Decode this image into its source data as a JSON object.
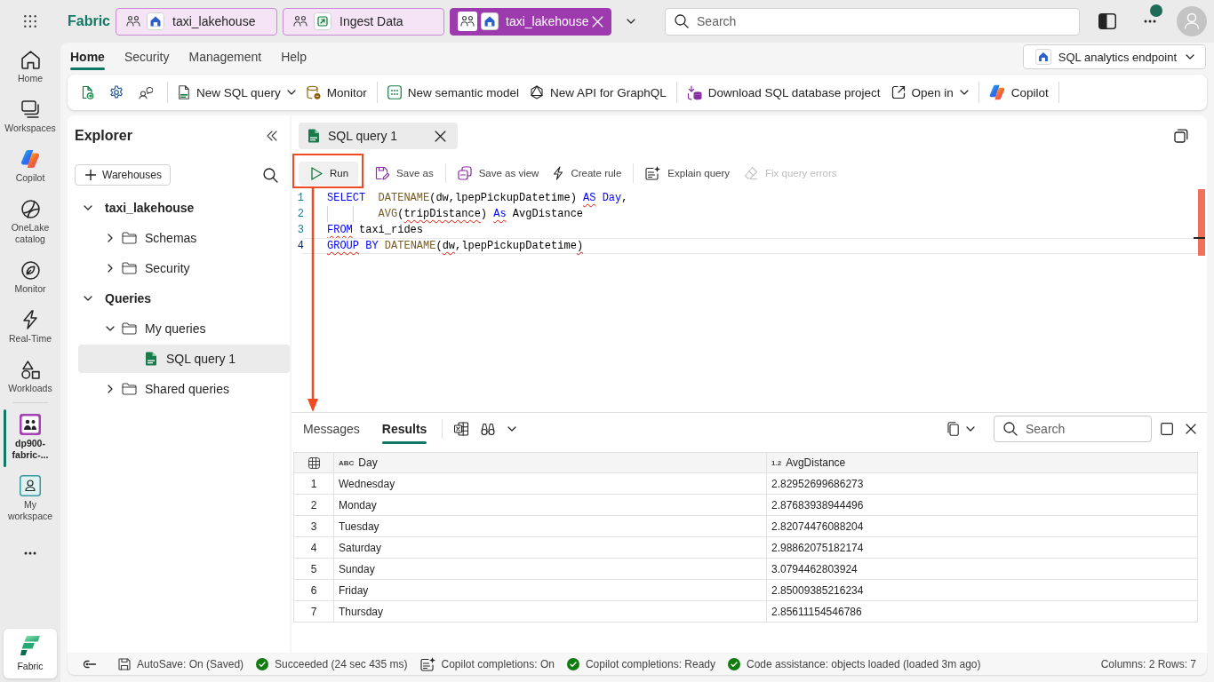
{
  "header": {
    "app_name": "Fabric",
    "tabs": [
      {
        "label": "taxi_lakehouse",
        "kind": "lakehouse",
        "selected": false
      },
      {
        "label": "Ingest Data",
        "kind": "pipeline",
        "selected": false
      },
      {
        "label": "taxi_lakehouse",
        "kind": "lakehouse",
        "selected": true
      }
    ],
    "search": {
      "placeholder": "Search"
    }
  },
  "nav_rail": {
    "items": [
      {
        "label": "Home",
        "kind": "home",
        "selected": false
      },
      {
        "label": "Workspaces",
        "kind": "workspaces",
        "selected": false
      },
      {
        "label": "Copilot",
        "kind": "copilot",
        "selected": false
      },
      {
        "label": "OneLake catalog",
        "kind": "onelake",
        "selected": false
      },
      {
        "label": "Monitor",
        "kind": "monitor",
        "selected": false
      },
      {
        "label": "Real-Time",
        "kind": "real-time",
        "selected": false
      },
      {
        "label": "Workloads",
        "kind": "workloads",
        "selected": false
      }
    ],
    "workspaces": [
      {
        "label": "dp900-fabric-...",
        "kind": "workspace",
        "selected": true
      },
      {
        "label": "My workspace",
        "kind": "my-workspace",
        "selected": false
      }
    ],
    "footer": {
      "label": "Fabric"
    }
  },
  "ribbon": {
    "menu_tabs": [
      {
        "label": "Home",
        "selected": true
      },
      {
        "label": "Security",
        "selected": false
      },
      {
        "label": "Management",
        "selected": false
      },
      {
        "label": "Help",
        "selected": false
      }
    ],
    "endpoint_selector": {
      "label": "SQL analytics endpoint"
    },
    "toolbar_groups": [
      {
        "items": [
          {
            "label": "New SQL query",
            "kind": "sql-query",
            "has_menu": true
          },
          {
            "label": "Monitor",
            "kind": "monitor",
            "has_menu": false
          }
        ]
      },
      {
        "items": [
          {
            "label": "New semantic model",
            "kind": "semantic-model",
            "has_menu": false
          },
          {
            "label": "New API for GraphQL",
            "kind": "graphql",
            "has_menu": false
          }
        ]
      },
      {
        "items": [
          {
            "label": "Download SQL database project",
            "kind": "download-project",
            "has_menu": false
          },
          {
            "label": "Open in",
            "kind": "open-in",
            "has_menu": true
          }
        ]
      },
      {
        "items": [
          {
            "label": "Copilot",
            "kind": "copilot",
            "has_menu": false
          }
        ]
      }
    ]
  },
  "explorer": {
    "title": "Explorer",
    "add_button": {
      "label": "Warehouses"
    },
    "tree": [
      {
        "label": "taxi_lakehouse",
        "kind": "group",
        "expanded": true,
        "selected": false,
        "children": [
          {
            "label": "Schemas",
            "kind": "folder",
            "expanded": false,
            "selected": false
          },
          {
            "label": "Security",
            "kind": "folder",
            "expanded": false,
            "selected": false
          }
        ]
      },
      {
        "label": "Queries",
        "kind": "group",
        "expanded": true,
        "selected": false,
        "children": [
          {
            "label": "My queries",
            "kind": "folder",
            "expanded": true,
            "selected": false,
            "children": [
              {
                "label": "SQL query 1",
                "kind": "query",
                "selected": true
              }
            ]
          },
          {
            "label": "Shared queries",
            "kind": "folder",
            "expanded": false,
            "selected": false
          }
        ]
      }
    ]
  },
  "editor": {
    "tab": {
      "label": "SQL query 1"
    },
    "toolbar_groups": [
      {
        "items": [
          {
            "label": "Run",
            "kind": "run",
            "disabled": false
          }
        ]
      },
      {
        "items": [
          {
            "label": "Save as",
            "kind": "save-as",
            "disabled": false
          }
        ]
      },
      {
        "items": [
          {
            "label": "Save as view",
            "kind": "save-as-view",
            "disabled": false
          },
          {
            "label": "Create rule",
            "kind": "create-rule",
            "disabled": false
          }
        ]
      },
      {
        "items": [
          {
            "label": "Explain query",
            "kind": "explain",
            "disabled": false
          },
          {
            "label": "Fix query errors",
            "kind": "fix-errors",
            "disabled": true
          }
        ]
      }
    ],
    "code": [
      {
        "number": "1",
        "current": false,
        "indented": false,
        "tokens": [
          {
            "text": "SELECT  ",
            "kind": "keyword",
            "error": false
          },
          {
            "text": "DATENAME",
            "kind": "function",
            "error": false
          },
          {
            "text": "(dw,lpepPickupDatetime) ",
            "kind": "plain",
            "error": false
          },
          {
            "text": "AS",
            "kind": "keyword",
            "error": true
          },
          {
            "text": " Day",
            "kind": "keyword",
            "error": false
          },
          {
            "text": ",",
            "kind": "plain",
            "error": false
          }
        ]
      },
      {
        "number": "2",
        "current": false,
        "indented": true,
        "tokens": [
          {
            "text": "AVG",
            "kind": "function",
            "error": false
          },
          {
            "text": "(",
            "kind": "plain",
            "error": false
          },
          {
            "text": "tripDistance",
            "kind": "plain",
            "error": true
          },
          {
            "text": ") ",
            "kind": "plain",
            "error": false
          },
          {
            "text": "As",
            "kind": "keyword",
            "error": true
          },
          {
            "text": " AvgDistance",
            "kind": "plain",
            "error": false
          }
        ]
      },
      {
        "number": "3",
        "current": false,
        "indented": false,
        "tokens": [
          {
            "text": "FROM",
            "kind": "keyword",
            "error": true
          },
          {
            "text": " taxi_rides",
            "kind": "plain",
            "error": false
          }
        ]
      },
      {
        "number": "4",
        "current": true,
        "indented": false,
        "tokens": [
          {
            "text": "GROUP",
            "kind": "keyword",
            "error": true
          },
          {
            "text": " BY",
            "kind": "keyword",
            "error": false
          },
          {
            "text": " DATENAME",
            "kind": "function",
            "error": false
          },
          {
            "text": "(",
            "kind": "plain",
            "error": false
          },
          {
            "text": "dw",
            "kind": "plain",
            "error": true
          },
          {
            "text": ",lpepPickupDatetime",
            "kind": "plain",
            "error": false
          },
          {
            "text": ")",
            "kind": "plain",
            "error": true
          }
        ]
      }
    ]
  },
  "results": {
    "tabs": [
      {
        "label": "Messages",
        "selected": false
      },
      {
        "label": "Results",
        "selected": true
      }
    ],
    "search": {
      "placeholder": "Search"
    },
    "table": {
      "columns": [
        {
          "type_label": "ABC",
          "label": "Day"
        },
        {
          "type_label": "1.2",
          "label": "AvgDistance"
        }
      ],
      "rows": [
        {
          "number": "1",
          "cells": [
            "Wednesday",
            "2.82952699686273"
          ]
        },
        {
          "number": "2",
          "cells": [
            "Monday",
            "2.87683938944496"
          ]
        },
        {
          "number": "3",
          "cells": [
            "Tuesday",
            "2.82074476088204"
          ]
        },
        {
          "number": "4",
          "cells": [
            "Saturday",
            "2.98862075182174"
          ]
        },
        {
          "number": "5",
          "cells": [
            "Sunday",
            "3.0794462803924"
          ]
        },
        {
          "number": "6",
          "cells": [
            "Friday",
            "2.85009385216234"
          ]
        },
        {
          "number": "7",
          "cells": [
            "Thursday",
            "2.85611154546786"
          ]
        }
      ]
    }
  },
  "status_bar": {
    "items": [
      {
        "kind": "autosave",
        "text": "AutoSave: On (Saved)"
      },
      {
        "kind": "success",
        "text": "Succeeded (24 sec 435 ms)"
      },
      {
        "kind": "copilot",
        "text": "Copilot completions: On"
      },
      {
        "kind": "success",
        "text": "Copilot completions: Ready"
      },
      {
        "kind": "success",
        "text": "Code assistance: objects loaded (loaded 3m ago)"
      }
    ],
    "summary": "Columns: 2 Rows: 7"
  }
}
